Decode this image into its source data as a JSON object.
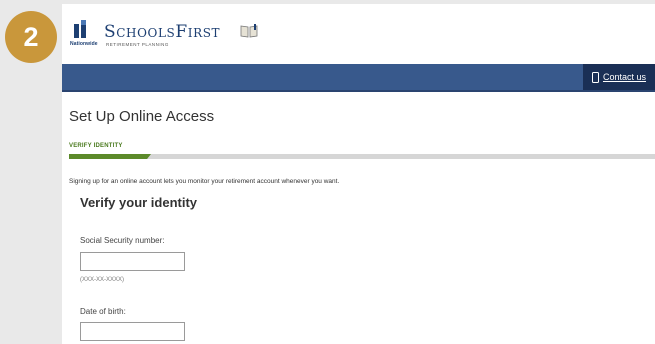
{
  "step_badge": "2",
  "brand": {
    "partner": "Nationwide",
    "name": "SchoolsFirst",
    "tagline": "RETIREMENT PLANNING"
  },
  "navbar": {
    "contact_label": "Contact us"
  },
  "page_title": "Set Up Online Access",
  "progress": {
    "step_label": "VERIFY IDENTITY",
    "fraction": 0.14
  },
  "intro_text": "Signing up for an online account lets you monitor your retirement account whenever you want.",
  "form": {
    "heading": "Verify your identity",
    "ssn": {
      "label": "Social Security number:",
      "value": "",
      "hint": "(XXX-XX-XXXX)"
    },
    "dob": {
      "label": "Date of birth:",
      "value": ""
    }
  },
  "colors": {
    "navbar": "#38598c",
    "contact_bg": "#1a2f55",
    "progress_fill": "#5c8a2a",
    "badge": "#c9973b"
  }
}
